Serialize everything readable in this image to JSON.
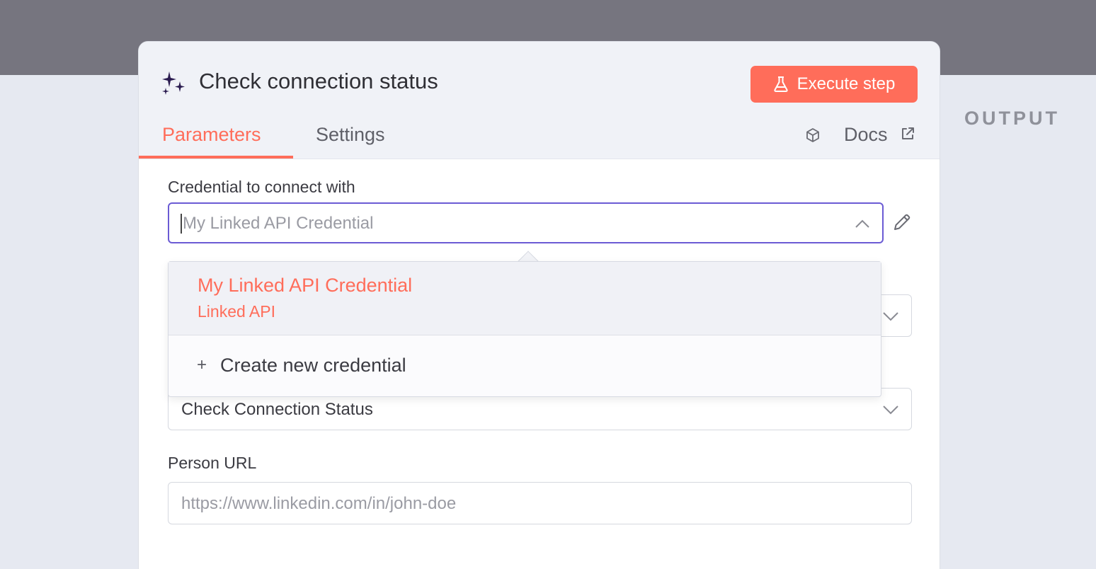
{
  "node": {
    "title": "Check connection status",
    "execute_label": "Execute step"
  },
  "tabs": {
    "parameters": "Parameters",
    "settings": "Settings",
    "docs": "Docs"
  },
  "output_label": "OUTPUT",
  "credential": {
    "label": "Credential to connect with",
    "placeholder": "My Linked API Credential"
  },
  "dropdown": {
    "option_name": "My Linked API Credential",
    "option_type": "Linked API",
    "create_label": "Create new credential"
  },
  "operation": {
    "value": "Check Connection Status"
  },
  "person_url": {
    "label": "Person URL",
    "placeholder": "https://www.linkedin.com/in/john-doe"
  },
  "colors": {
    "accent": "#ff6d5a",
    "focus_border": "#6b5bd4",
    "overlay": "#76757f"
  },
  "icons": [
    "sparkles-icon",
    "flask-icon",
    "cube-icon",
    "external-link-icon",
    "chevron-up-icon",
    "pencil-icon",
    "chevron-down-icon",
    "plus-icon"
  ]
}
